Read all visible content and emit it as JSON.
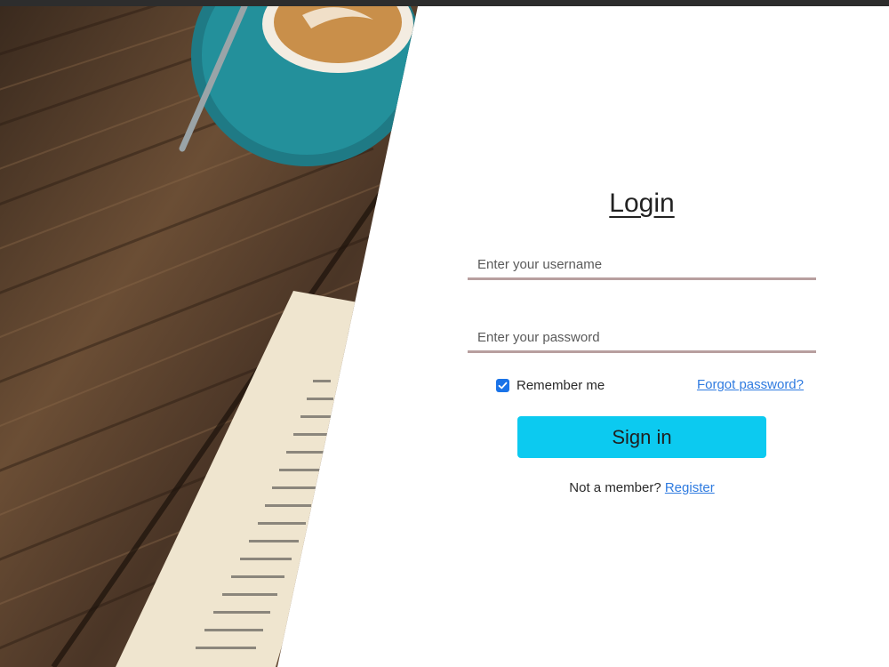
{
  "login": {
    "title": "Login",
    "username_placeholder": "Enter your username",
    "password_placeholder": "Enter your password",
    "remember_label": "Remember me",
    "remember_checked": true,
    "forgot_label": "Forgot password?",
    "signin_label": "Sign in",
    "not_member_text": "Not a member?",
    "register_label": "Register"
  },
  "colors": {
    "accent_button": "#0ccaf0",
    "link": "#2f7be0",
    "field_underline": "#b89f9f",
    "checkbox": "#1a73e8"
  }
}
